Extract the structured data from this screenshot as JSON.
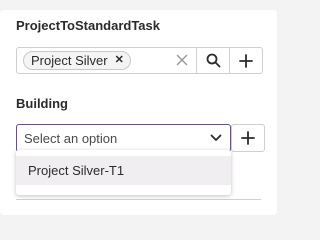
{
  "fields": {
    "project": {
      "label": "ProjectToStandardTask",
      "chips": [
        "Project Silver"
      ],
      "icons": {
        "chip_remove": "close-icon",
        "clear": "close-icon",
        "search": "search-icon",
        "add": "plus-icon"
      }
    },
    "building": {
      "label": "Building",
      "placeholder": "Select an option",
      "icons": {
        "toggle": "chevron-down-icon",
        "add": "plus-icon"
      },
      "options": [
        "Project Silver-T1"
      ]
    }
  },
  "colors": {
    "focus_border": "#6a4a9b",
    "option_highlight": "#f1eef2",
    "background": "#f3f3f3"
  }
}
